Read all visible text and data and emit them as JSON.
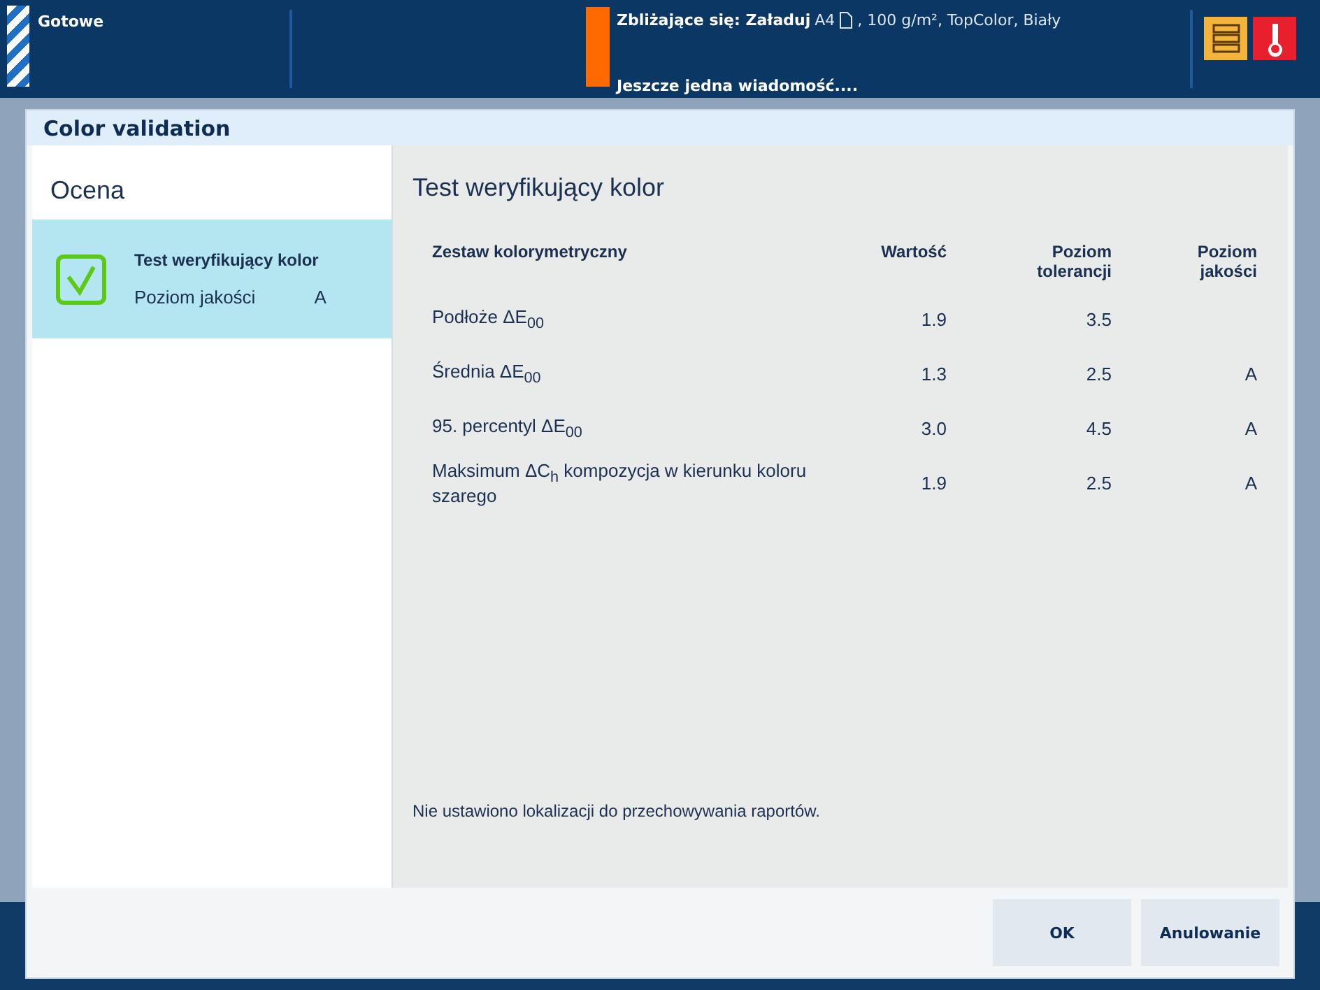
{
  "status_bar": {
    "state": "Gotowe",
    "upcoming_label": "Zbliżające się: Załaduj",
    "upcoming_detail_1": "A4",
    "upcoming_detail_2": ", 100 g/m², TopColor, Biały",
    "message": "Jeszcze jedna wiadomość...."
  },
  "dialog": {
    "title": "Color validation",
    "sidebar": {
      "heading": "Ocena",
      "items": [
        {
          "title": "Test weryfikujący kolor",
          "label": "Poziom jakości",
          "grade": "A",
          "selected": true,
          "passed": true
        }
      ]
    },
    "content": {
      "heading": "Test weryfikujący kolor",
      "columns": [
        "Zestaw kolorymetryczny",
        "Wartość",
        "Poziom tolerancji",
        "Poziom jakości"
      ],
      "rows": [
        {
          "name": "Podłoże ΔE$_{00}$",
          "value": "1.9",
          "tolerance": "3.5"
        },
        {
          "name": "Średnia ΔE$_{00}$",
          "value": "1.3",
          "tolerance": "2.5",
          "grade": "A"
        },
        {
          "name": "95. percentyl ΔE$_{00}$",
          "value": "3.0",
          "tolerance": "4.5",
          "grade": "A"
        },
        {
          "name": "Maksimum ΔC$_{h}$ kompozycja w kierunku koloru szarego",
          "value": "1.9",
          "tolerance": "2.5",
          "grade": "A"
        }
      ],
      "note": "Nie ustawiono lokalizacji do przechowywania raportów."
    },
    "buttons": [
      "OK",
      "Anulowanie"
    ]
  }
}
